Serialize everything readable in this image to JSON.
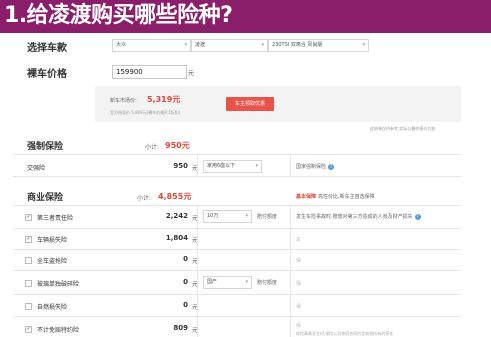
{
  "banner": {
    "title": "1.给凌渡购买哪些险种?"
  },
  "car": {
    "label": "选择车款",
    "brand": "大众",
    "series": "凌渡",
    "model": "230TSI 双离合 风尚版"
  },
  "price": {
    "label": "裸车价格",
    "value": "159900",
    "unit": "元"
  },
  "summary": {
    "market_label": "新车市场价:",
    "market_value": "5,319元",
    "formula": "官方指导价 5,809元(裸车价格9:1折扣)",
    "button_label": "车主领取优惠",
    "note": "此结果仅供参考,实际以最终报价为准"
  },
  "compulsory": {
    "title": "强制保险",
    "subtotal_label": "小计:",
    "subtotal_value": "950元",
    "rows": [
      {
        "name": "交强险",
        "amount": "950",
        "unit": "元",
        "option": "家用6座以下",
        "desc": "国家强制保险"
      }
    ]
  },
  "commercial": {
    "title": "商业保险",
    "subtotal_label": "小计:",
    "subtotal_value": "4,855元",
    "header_tag": "基本保障",
    "header_desc": "高性价比,新车主首选保障",
    "rows": [
      {
        "name": "第三者责任险",
        "checked": true,
        "amount": "2,242",
        "unit": "元",
        "option": "10万",
        "option_tag": "赔付额度",
        "desc": "发生车险事故时,赔偿对第三方造成的人身及财产损失"
      },
      {
        "name": "车辆损失险",
        "checked": true,
        "amount": "1,804",
        "unit": "元",
        "option": "",
        "option_tag": "",
        "desc": "车"
      },
      {
        "name": "全车盗抢险",
        "checked": false,
        "amount": "0",
        "unit": "元",
        "option": "",
        "option_tag": "",
        "desc": "保"
      },
      {
        "name": "玻璃单独破碎险",
        "checked": false,
        "amount": "0",
        "unit": "元",
        "option": "国产",
        "option_tag": "赔付额度",
        "desc": "保"
      },
      {
        "name": "自燃损失险",
        "checked": false,
        "amount": "0",
        "unit": "元",
        "option": "",
        "option_tag": "",
        "desc": "保"
      },
      {
        "name": "不计免赔特约险",
        "checked": true,
        "amount": "809",
        "unit": "元",
        "option": "",
        "option_tag": "",
        "desc": "保"
      }
    ],
    "bottom_desc": "保险事故发生时,保险公司按照合同约定赔偿所有的责任"
  },
  "colors": {
    "banner": "#8a1e6a",
    "accent": "#e0483c",
    "info": "#5b9bd5"
  }
}
